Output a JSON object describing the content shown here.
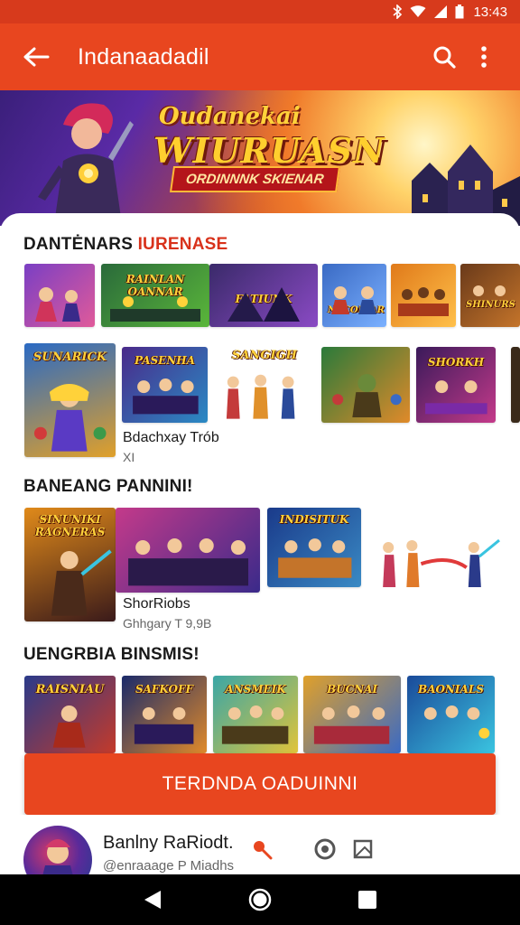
{
  "status_bar": {
    "time": "13:43"
  },
  "app_bar": {
    "title": "Indanaadadil"
  },
  "hero": {
    "line1": "Oudanekai",
    "line2": "WIURUASN",
    "ribbon": "ORDINNNK SKIENAR"
  },
  "sections": [
    {
      "title_main": "DANTĖNARS",
      "title_accent": "IURENASE"
    },
    {
      "title": "BANEANG PANNINI!"
    },
    {
      "title": "UENGRBIA BINSMIS!"
    }
  ],
  "row1_tiles": [
    {
      "label": ""
    },
    {
      "label": "RAINLAN OANNAR"
    },
    {
      "label": "FATIUNK"
    },
    {
      "label": "NACODIAR"
    },
    {
      "label": ""
    },
    {
      "label": "SHINURS"
    }
  ],
  "row2_tiles": [
    {
      "label": "SUNARICK"
    },
    {
      "label": "PASENHA"
    },
    {
      "label": "SANGIGH"
    },
    {
      "label": ""
    },
    {
      "label": "SHORKH"
    }
  ],
  "row2_item": {
    "caption": "Bdachxay Trób",
    "sub": "XI"
  },
  "row3_tiles": [
    {
      "label": "SINUNIKI RAGNERAS"
    },
    {
      "label": ""
    },
    {
      "label": "INDISITUK"
    },
    {
      "label": ""
    }
  ],
  "row3_item": {
    "caption": "ShorRiobs",
    "sub": "Ghhgary T 9,9B"
  },
  "row4_tiles": [
    {
      "label": "RAISNIAU"
    },
    {
      "label": "SAFKOFF"
    },
    {
      "label": "ANSMEIK"
    },
    {
      "label": "BUCNAI"
    },
    {
      "label": "BAONIALS"
    }
  ],
  "cta": {
    "label": "TERDNDA OADUINNI"
  },
  "bottom_card": {
    "title": "Banlny RaRiodt.",
    "subtitle": "@enraaage P Miadhs"
  },
  "colors": {
    "primary": "#e8461f",
    "status_bar": "#d73a1c",
    "accent_text": "#d8321b"
  },
  "icons": [
    "back-arrow-icon",
    "search-icon",
    "more-vert-icon",
    "bluetooth-icon",
    "wifi-icon",
    "signal-icon",
    "battery-icon",
    "pin-icon",
    "record-icon",
    "cast-icon",
    "nav-back-icon",
    "nav-home-icon",
    "nav-recents-icon"
  ]
}
